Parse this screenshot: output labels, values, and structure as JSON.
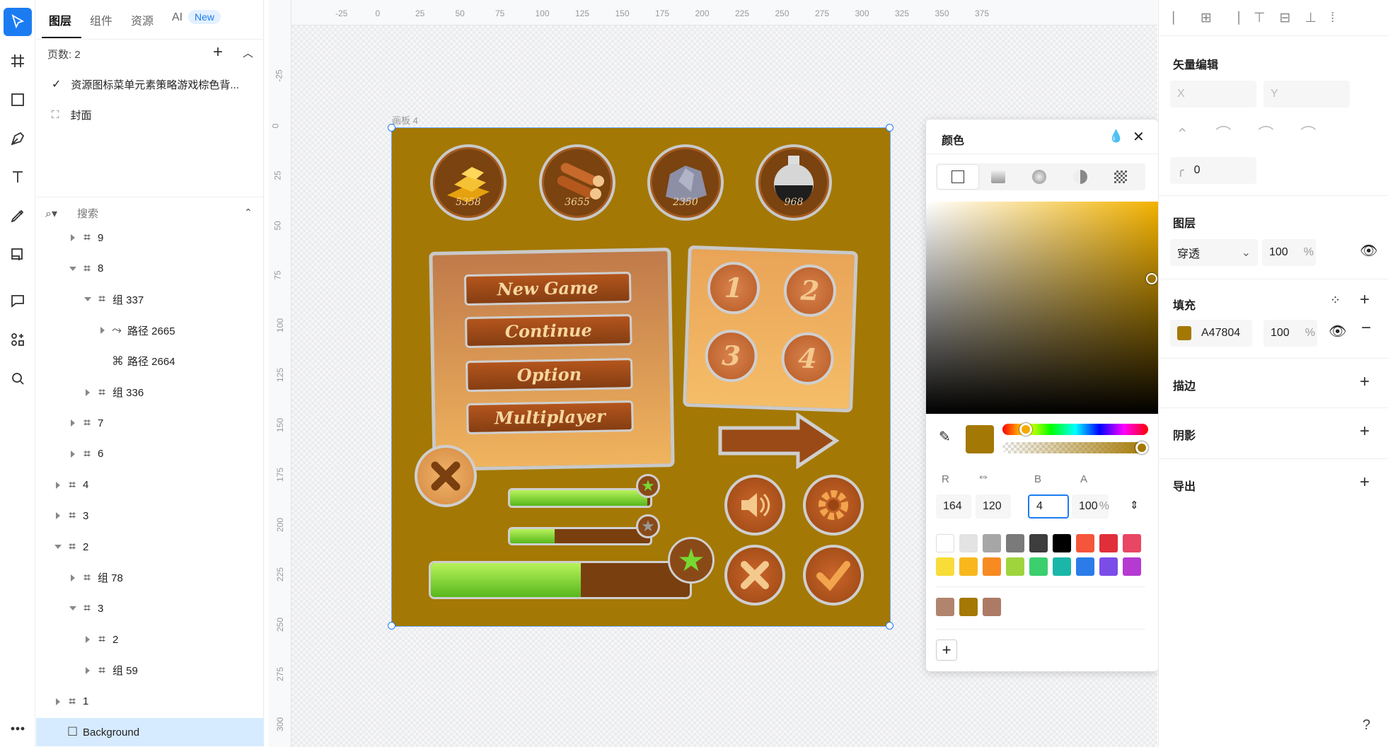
{
  "left_panel": {
    "tabs": [
      "图层",
      "组件",
      "资源",
      "AI"
    ],
    "new_badge": "New",
    "pages_label": "页数: 2",
    "pages": [
      "资源图标菜单元素策略游戏棕色背...",
      "封面"
    ],
    "search_placeholder": "搜索",
    "layers": [
      {
        "label": "9",
        "indent": 1,
        "expand": "r",
        "kind": "frame"
      },
      {
        "label": "8",
        "indent": 1,
        "expand": "d",
        "kind": "frame"
      },
      {
        "label": "组 337",
        "indent": 2,
        "expand": "d",
        "kind": "frame"
      },
      {
        "label": "路径 2665",
        "indent": 3,
        "expand": "r",
        "kind": "path"
      },
      {
        "label": "路径 2664",
        "indent": 3,
        "expand": "",
        "kind": "path2"
      },
      {
        "label": "组 336",
        "indent": 2,
        "expand": "r",
        "kind": "frame"
      },
      {
        "label": "7",
        "indent": 1,
        "expand": "r",
        "kind": "frame"
      },
      {
        "label": "6",
        "indent": 1,
        "expand": "r",
        "kind": "frame"
      },
      {
        "label": "4",
        "indent": 0,
        "expand": "r",
        "kind": "frame"
      },
      {
        "label": "3",
        "indent": 0,
        "expand": "r",
        "kind": "frame"
      },
      {
        "label": "2",
        "indent": 0,
        "expand": "d",
        "kind": "frame"
      },
      {
        "label": "组 78",
        "indent": 1,
        "expand": "r",
        "kind": "frame"
      },
      {
        "label": "3",
        "indent": 1,
        "expand": "d",
        "kind": "frame"
      },
      {
        "label": "2",
        "indent": 2,
        "expand": "r",
        "kind": "frame"
      },
      {
        "label": "组 59",
        "indent": 2,
        "expand": "r",
        "kind": "frame"
      },
      {
        "label": "1",
        "indent": 0,
        "expand": "r",
        "kind": "frame"
      },
      {
        "label": "Background",
        "indent": 0,
        "expand": "",
        "kind": "rect",
        "selected": true
      }
    ]
  },
  "ruler": {
    "h": [
      "-25",
      "0",
      "25",
      "50",
      "75",
      "100",
      "125",
      "150",
      "175",
      "200",
      "225",
      "250",
      "275",
      "300",
      "325",
      "350",
      "375"
    ],
    "v": [
      "-25",
      "0",
      "25",
      "50",
      "75",
      "100",
      "125",
      "150",
      "175",
      "200",
      "225",
      "250",
      "275",
      "300"
    ]
  },
  "artboard": {
    "label": "画板 4",
    "bg_color": "#A47804",
    "resources": [
      "5358",
      "3655",
      "2350",
      "968"
    ],
    "menu_buttons": [
      "New Game",
      "Continue",
      "Option",
      "Multiplayer"
    ],
    "level_buttons": [
      "1",
      "2",
      "3",
      "4"
    ],
    "progress": [
      0.98,
      0.32,
      0.58
    ]
  },
  "color_panel": {
    "title": "颜色",
    "channels": {
      "r_label": "R",
      "b_label": "B",
      "a_label": "A",
      "r": "164",
      "g": "120",
      "b": "4",
      "a": "100",
      "pct": "%"
    },
    "swatches_row1": [
      "#ffffff",
      "#e3e3e3",
      "#a6a6a6",
      "#7a7a7a",
      "#3d3d3d",
      "#000000",
      "#f4553b",
      "#e02f3a",
      "#e94664"
    ],
    "swatches_row2": [
      "#f8dc38",
      "#f8b81d",
      "#f88a22",
      "#9fd43d",
      "#3bcf6e",
      "#1ab7a8",
      "#2b7ce9",
      "#7b4de8",
      "#b53ad1"
    ],
    "recent": [
      "#b1846e",
      "#a47804",
      "#ad7a66"
    ]
  },
  "right_panel": {
    "vector_edit": "矢量编辑",
    "x_placeholder": "X",
    "y_placeholder": "Y",
    "radius": "0",
    "layer_title": "图层",
    "blend_mode": "穿透",
    "layer_opacity": "100",
    "pct": "%",
    "fill_title": "填充",
    "fill_hex": "A47804",
    "fill_opacity": "100",
    "stroke_title": "描边",
    "shadow_title": "阴影",
    "export_title": "导出",
    "help": "?"
  }
}
